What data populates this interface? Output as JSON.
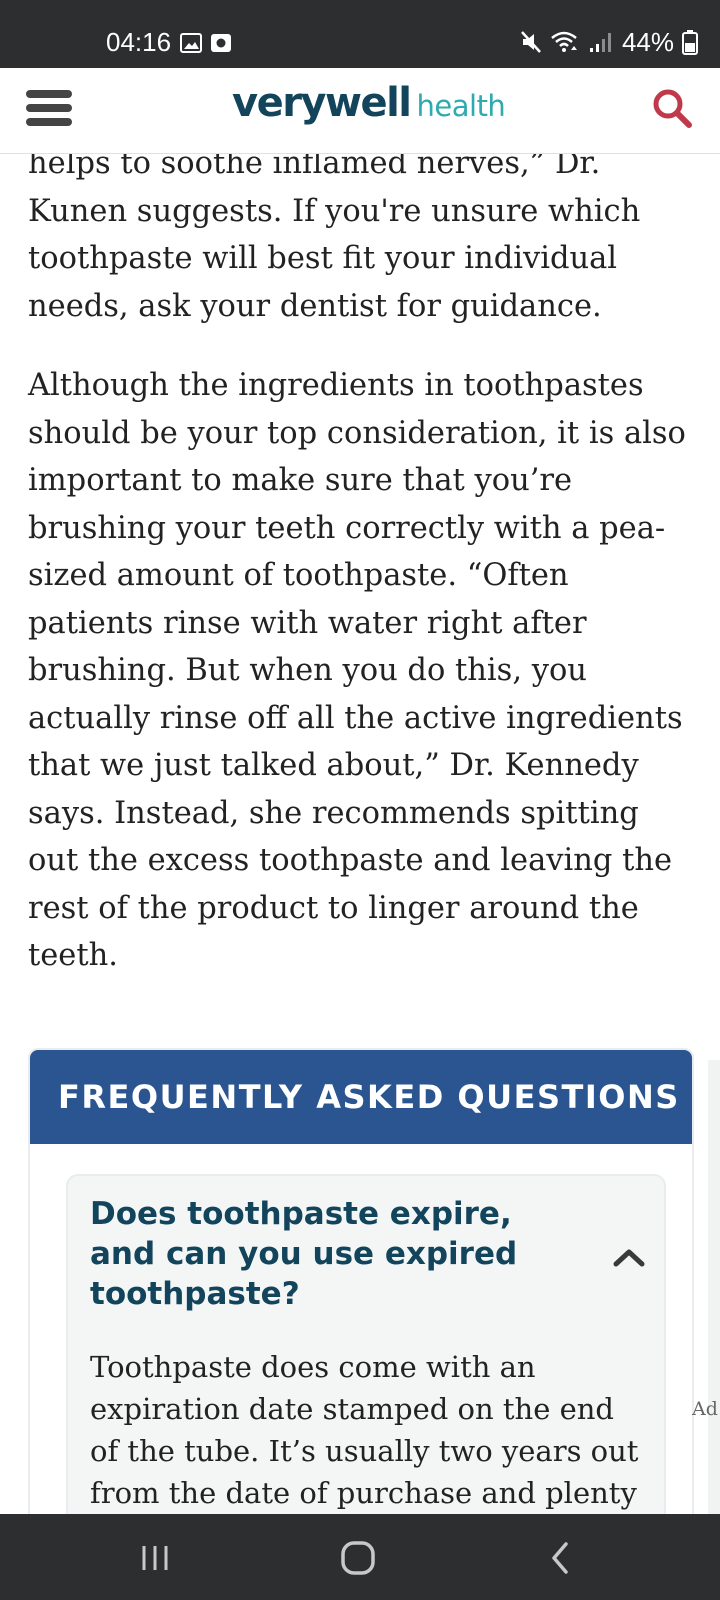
{
  "status_bar": {
    "time": "04:16",
    "left_icons": [
      "gallery-icon",
      "screen-record-icon"
    ],
    "right_icons": [
      "mute-icon",
      "wifi-icon",
      "signal-icon",
      "battery-icon"
    ],
    "battery": "44%"
  },
  "header": {
    "logo_primary": "verywell",
    "logo_secondary": "health",
    "brand_color": "#12445c",
    "accent_color": "#2eaab0",
    "search_color": "#c0394b"
  },
  "article": {
    "paragraphs": [
      "helps to soothe inflamed nerves,” Dr. Kunen suggests. If you're unsure which toothpaste will best fit your individual needs, ask your dentist for guidance.",
      "Although the ingredients in toothpastes should be your top consideration, it is also important to make sure that you’re brushing your teeth correctly with a pea-sized amount of toothpaste. “Often patients rinse with water right after brushing. But when you do this, you actually rinse off all the active ingredients that we just talked about,” Dr. Kennedy says. Instead, she recommends spitting out the excess toothpaste and leaving the rest of the product to linger around the teeth."
    ]
  },
  "faq": {
    "title": "FREQUENTLY ASKED QUESTIONS",
    "header_color": "#2a5590",
    "items": [
      {
        "question": "Does toothpaste expire, and can you use expired toothpaste?",
        "expanded": true,
        "answer": "Toothpaste does come with an expiration date stamped on the end of the tube. It’s usually two years out from the date of purchase and plenty of"
      }
    ]
  },
  "ad_label": "Ad",
  "nav_bar": {
    "buttons": [
      "recent-apps",
      "home",
      "back"
    ]
  }
}
